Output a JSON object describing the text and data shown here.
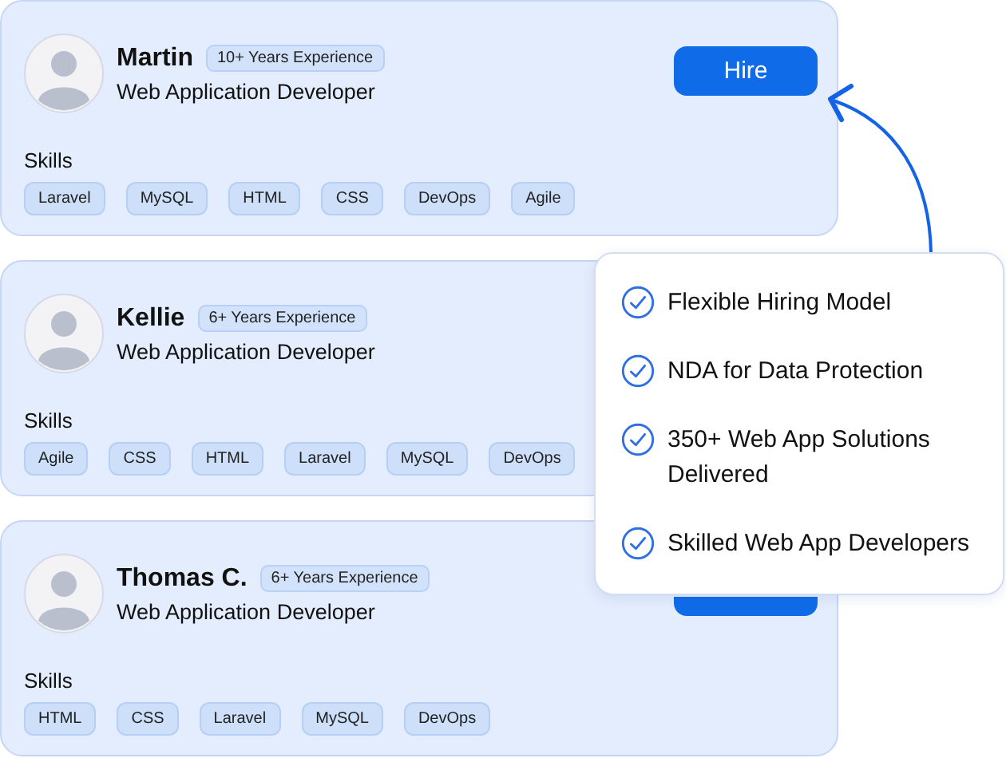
{
  "developers": [
    {
      "name": "Martin",
      "experience": "10+ Years Experience",
      "title": "Web Application Developer",
      "hire": "Hire",
      "skills_label": "Skills",
      "skills": [
        "Laravel",
        "MySQL",
        "HTML",
        "CSS",
        "DevOps",
        "Agile"
      ]
    },
    {
      "name": "Kellie",
      "experience": "6+ Years Experience",
      "title": "Web Application Developer",
      "skills_label": "Skills",
      "skills": [
        "Agile",
        "CSS",
        "HTML",
        "Laravel",
        "MySQL",
        "DevOps"
      ]
    },
    {
      "name": "Thomas C.",
      "experience": "6+ Years Experience",
      "title": "Web Application Developer",
      "hire_partly_covered": true,
      "skills_label": "Skills",
      "skills": [
        "HTML",
        "CSS",
        "Laravel",
        "MySQL",
        "DevOps"
      ]
    }
  ],
  "benefits": [
    "Flexible Hiring Model",
    "NDA for Data Protection",
    "350+ Web App Solutions Delivered",
    "Skilled Web App Developers"
  ]
}
